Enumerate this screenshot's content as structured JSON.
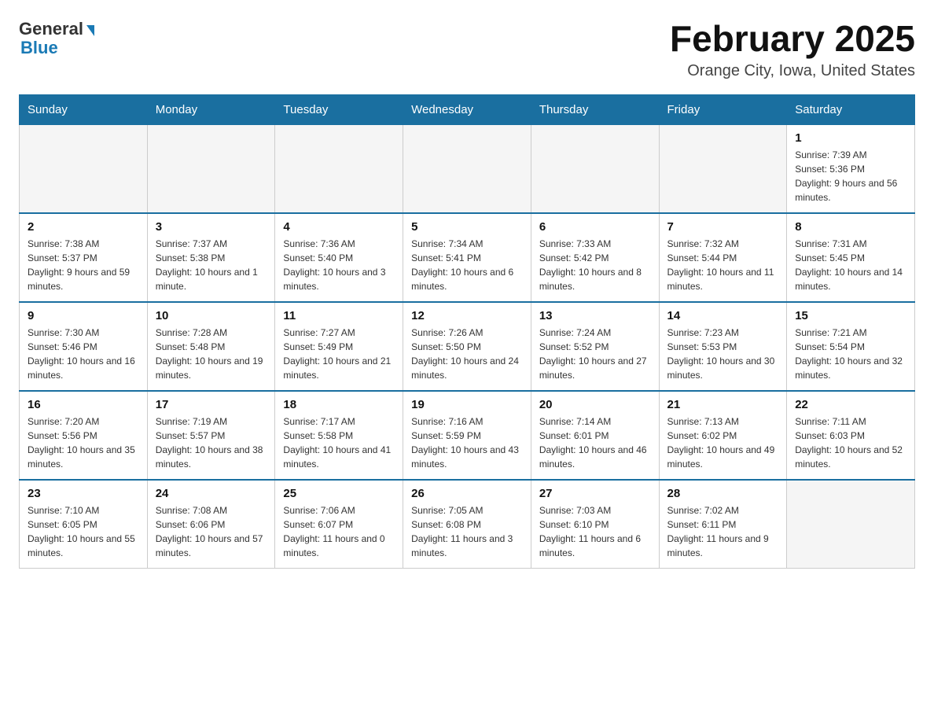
{
  "header": {
    "logo_general": "General",
    "logo_blue": "Blue",
    "month_title": "February 2025",
    "location": "Orange City, Iowa, United States"
  },
  "days_of_week": [
    "Sunday",
    "Monday",
    "Tuesday",
    "Wednesday",
    "Thursday",
    "Friday",
    "Saturday"
  ],
  "weeks": [
    [
      {
        "day": "",
        "sunrise": "",
        "sunset": "",
        "daylight": "",
        "empty": true
      },
      {
        "day": "",
        "sunrise": "",
        "sunset": "",
        "daylight": "",
        "empty": true
      },
      {
        "day": "",
        "sunrise": "",
        "sunset": "",
        "daylight": "",
        "empty": true
      },
      {
        "day": "",
        "sunrise": "",
        "sunset": "",
        "daylight": "",
        "empty": true
      },
      {
        "day": "",
        "sunrise": "",
        "sunset": "",
        "daylight": "",
        "empty": true
      },
      {
        "day": "",
        "sunrise": "",
        "sunset": "",
        "daylight": "",
        "empty": true
      },
      {
        "day": "1",
        "sunrise": "Sunrise: 7:39 AM",
        "sunset": "Sunset: 5:36 PM",
        "daylight": "Daylight: 9 hours and 56 minutes.",
        "empty": false
      }
    ],
    [
      {
        "day": "2",
        "sunrise": "Sunrise: 7:38 AM",
        "sunset": "Sunset: 5:37 PM",
        "daylight": "Daylight: 9 hours and 59 minutes.",
        "empty": false
      },
      {
        "day": "3",
        "sunrise": "Sunrise: 7:37 AM",
        "sunset": "Sunset: 5:38 PM",
        "daylight": "Daylight: 10 hours and 1 minute.",
        "empty": false
      },
      {
        "day": "4",
        "sunrise": "Sunrise: 7:36 AM",
        "sunset": "Sunset: 5:40 PM",
        "daylight": "Daylight: 10 hours and 3 minutes.",
        "empty": false
      },
      {
        "day": "5",
        "sunrise": "Sunrise: 7:34 AM",
        "sunset": "Sunset: 5:41 PM",
        "daylight": "Daylight: 10 hours and 6 minutes.",
        "empty": false
      },
      {
        "day": "6",
        "sunrise": "Sunrise: 7:33 AM",
        "sunset": "Sunset: 5:42 PM",
        "daylight": "Daylight: 10 hours and 8 minutes.",
        "empty": false
      },
      {
        "day": "7",
        "sunrise": "Sunrise: 7:32 AM",
        "sunset": "Sunset: 5:44 PM",
        "daylight": "Daylight: 10 hours and 11 minutes.",
        "empty": false
      },
      {
        "day": "8",
        "sunrise": "Sunrise: 7:31 AM",
        "sunset": "Sunset: 5:45 PM",
        "daylight": "Daylight: 10 hours and 14 minutes.",
        "empty": false
      }
    ],
    [
      {
        "day": "9",
        "sunrise": "Sunrise: 7:30 AM",
        "sunset": "Sunset: 5:46 PM",
        "daylight": "Daylight: 10 hours and 16 minutes.",
        "empty": false
      },
      {
        "day": "10",
        "sunrise": "Sunrise: 7:28 AM",
        "sunset": "Sunset: 5:48 PM",
        "daylight": "Daylight: 10 hours and 19 minutes.",
        "empty": false
      },
      {
        "day": "11",
        "sunrise": "Sunrise: 7:27 AM",
        "sunset": "Sunset: 5:49 PM",
        "daylight": "Daylight: 10 hours and 21 minutes.",
        "empty": false
      },
      {
        "day": "12",
        "sunrise": "Sunrise: 7:26 AM",
        "sunset": "Sunset: 5:50 PM",
        "daylight": "Daylight: 10 hours and 24 minutes.",
        "empty": false
      },
      {
        "day": "13",
        "sunrise": "Sunrise: 7:24 AM",
        "sunset": "Sunset: 5:52 PM",
        "daylight": "Daylight: 10 hours and 27 minutes.",
        "empty": false
      },
      {
        "day": "14",
        "sunrise": "Sunrise: 7:23 AM",
        "sunset": "Sunset: 5:53 PM",
        "daylight": "Daylight: 10 hours and 30 minutes.",
        "empty": false
      },
      {
        "day": "15",
        "sunrise": "Sunrise: 7:21 AM",
        "sunset": "Sunset: 5:54 PM",
        "daylight": "Daylight: 10 hours and 32 minutes.",
        "empty": false
      }
    ],
    [
      {
        "day": "16",
        "sunrise": "Sunrise: 7:20 AM",
        "sunset": "Sunset: 5:56 PM",
        "daylight": "Daylight: 10 hours and 35 minutes.",
        "empty": false
      },
      {
        "day": "17",
        "sunrise": "Sunrise: 7:19 AM",
        "sunset": "Sunset: 5:57 PM",
        "daylight": "Daylight: 10 hours and 38 minutes.",
        "empty": false
      },
      {
        "day": "18",
        "sunrise": "Sunrise: 7:17 AM",
        "sunset": "Sunset: 5:58 PM",
        "daylight": "Daylight: 10 hours and 41 minutes.",
        "empty": false
      },
      {
        "day": "19",
        "sunrise": "Sunrise: 7:16 AM",
        "sunset": "Sunset: 5:59 PM",
        "daylight": "Daylight: 10 hours and 43 minutes.",
        "empty": false
      },
      {
        "day": "20",
        "sunrise": "Sunrise: 7:14 AM",
        "sunset": "Sunset: 6:01 PM",
        "daylight": "Daylight: 10 hours and 46 minutes.",
        "empty": false
      },
      {
        "day": "21",
        "sunrise": "Sunrise: 7:13 AM",
        "sunset": "Sunset: 6:02 PM",
        "daylight": "Daylight: 10 hours and 49 minutes.",
        "empty": false
      },
      {
        "day": "22",
        "sunrise": "Sunrise: 7:11 AM",
        "sunset": "Sunset: 6:03 PM",
        "daylight": "Daylight: 10 hours and 52 minutes.",
        "empty": false
      }
    ],
    [
      {
        "day": "23",
        "sunrise": "Sunrise: 7:10 AM",
        "sunset": "Sunset: 6:05 PM",
        "daylight": "Daylight: 10 hours and 55 minutes.",
        "empty": false
      },
      {
        "day": "24",
        "sunrise": "Sunrise: 7:08 AM",
        "sunset": "Sunset: 6:06 PM",
        "daylight": "Daylight: 10 hours and 57 minutes.",
        "empty": false
      },
      {
        "day": "25",
        "sunrise": "Sunrise: 7:06 AM",
        "sunset": "Sunset: 6:07 PM",
        "daylight": "Daylight: 11 hours and 0 minutes.",
        "empty": false
      },
      {
        "day": "26",
        "sunrise": "Sunrise: 7:05 AM",
        "sunset": "Sunset: 6:08 PM",
        "daylight": "Daylight: 11 hours and 3 minutes.",
        "empty": false
      },
      {
        "day": "27",
        "sunrise": "Sunrise: 7:03 AM",
        "sunset": "Sunset: 6:10 PM",
        "daylight": "Daylight: 11 hours and 6 minutes.",
        "empty": false
      },
      {
        "day": "28",
        "sunrise": "Sunrise: 7:02 AM",
        "sunset": "Sunset: 6:11 PM",
        "daylight": "Daylight: 11 hours and 9 minutes.",
        "empty": false
      },
      {
        "day": "",
        "sunrise": "",
        "sunset": "",
        "daylight": "",
        "empty": true
      }
    ]
  ]
}
